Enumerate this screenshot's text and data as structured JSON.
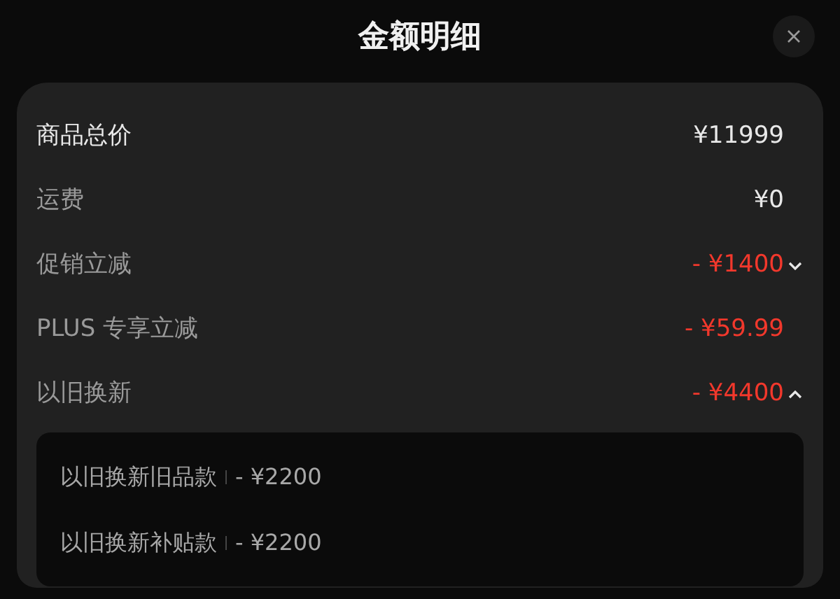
{
  "title": "金额明细",
  "rows": [
    {
      "label": "商品总价",
      "value": "¥11999",
      "kind": "total"
    },
    {
      "label": "运费",
      "value": "¥0",
      "kind": "plain"
    },
    {
      "label": "促销立减",
      "value": "- ¥1400",
      "kind": "discount",
      "expanded": false
    },
    {
      "label": "PLUS 专享立减",
      "value": "- ¥59.99",
      "kind": "discount"
    },
    {
      "label": "以旧换新",
      "value": "- ¥4400",
      "kind": "discount",
      "expanded": true,
      "children": [
        {
          "label": "以旧换新旧品款",
          "value": "- ¥2200"
        },
        {
          "label": "以旧换新补贴款",
          "value": "- ¥2200"
        }
      ]
    }
  ]
}
